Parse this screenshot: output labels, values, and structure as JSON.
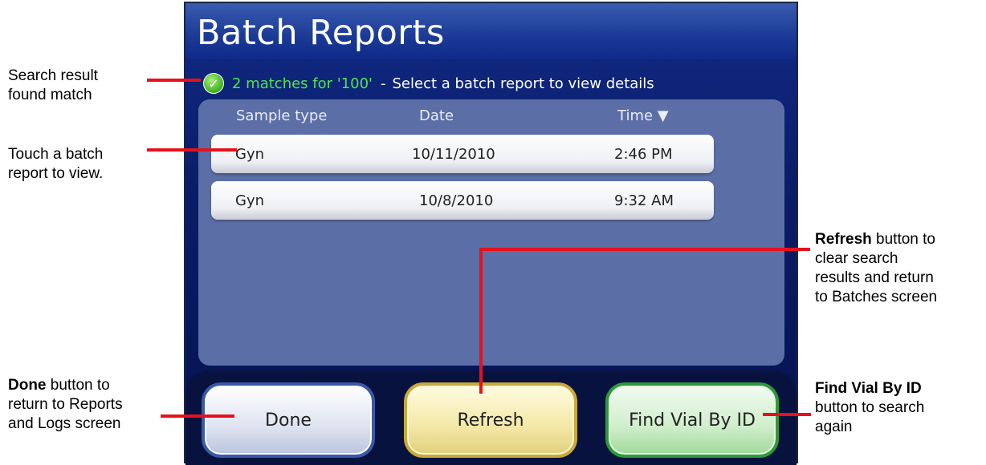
{
  "screen": {
    "title": "Batch Reports",
    "status": {
      "match_text": "2 matches for '100'",
      "separator": "-",
      "hint": "Select a batch report to view details"
    },
    "table": {
      "columns": [
        "Sample type",
        "Date",
        "Time ▼"
      ],
      "rows": [
        {
          "sample_type": "Gyn",
          "date": "10/11/2010",
          "time": "2:46 PM"
        },
        {
          "sample_type": "Gyn",
          "date": "10/8/2010",
          "time": "9:32 AM"
        }
      ]
    },
    "buttons": {
      "done": "Done",
      "refresh": "Refresh",
      "find": "Find Vial By ID"
    }
  },
  "annotations": {
    "search_result": {
      "line1": "Search result",
      "line2": "found match"
    },
    "touch_row": {
      "line1": "Touch a batch",
      "line2": "report to view."
    },
    "done": {
      "bold": "Done",
      "rest1": " button to",
      "line2": "return to Reports",
      "line3": "and Logs screen"
    },
    "refresh": {
      "bold": "Refresh",
      "rest1": " button to",
      "line2": "clear search",
      "line3": "results and return",
      "line4": "to Batches screen"
    },
    "find": {
      "bold": "Find Vial By ID",
      "line2": "button to search",
      "line3": "again"
    }
  },
  "colors": {
    "screen_bg": "#0a1d68",
    "panel_bg": "#5b6ea6",
    "match_green": "#4ce84c",
    "callout_red": "#e8101a",
    "done_border": "#3a5aa8",
    "refresh_border": "#c9a93a",
    "find_border": "#2e9a3a"
  },
  "icons": {
    "status": "checkmark-circle-icon",
    "sort": "sort-down-triangle"
  }
}
